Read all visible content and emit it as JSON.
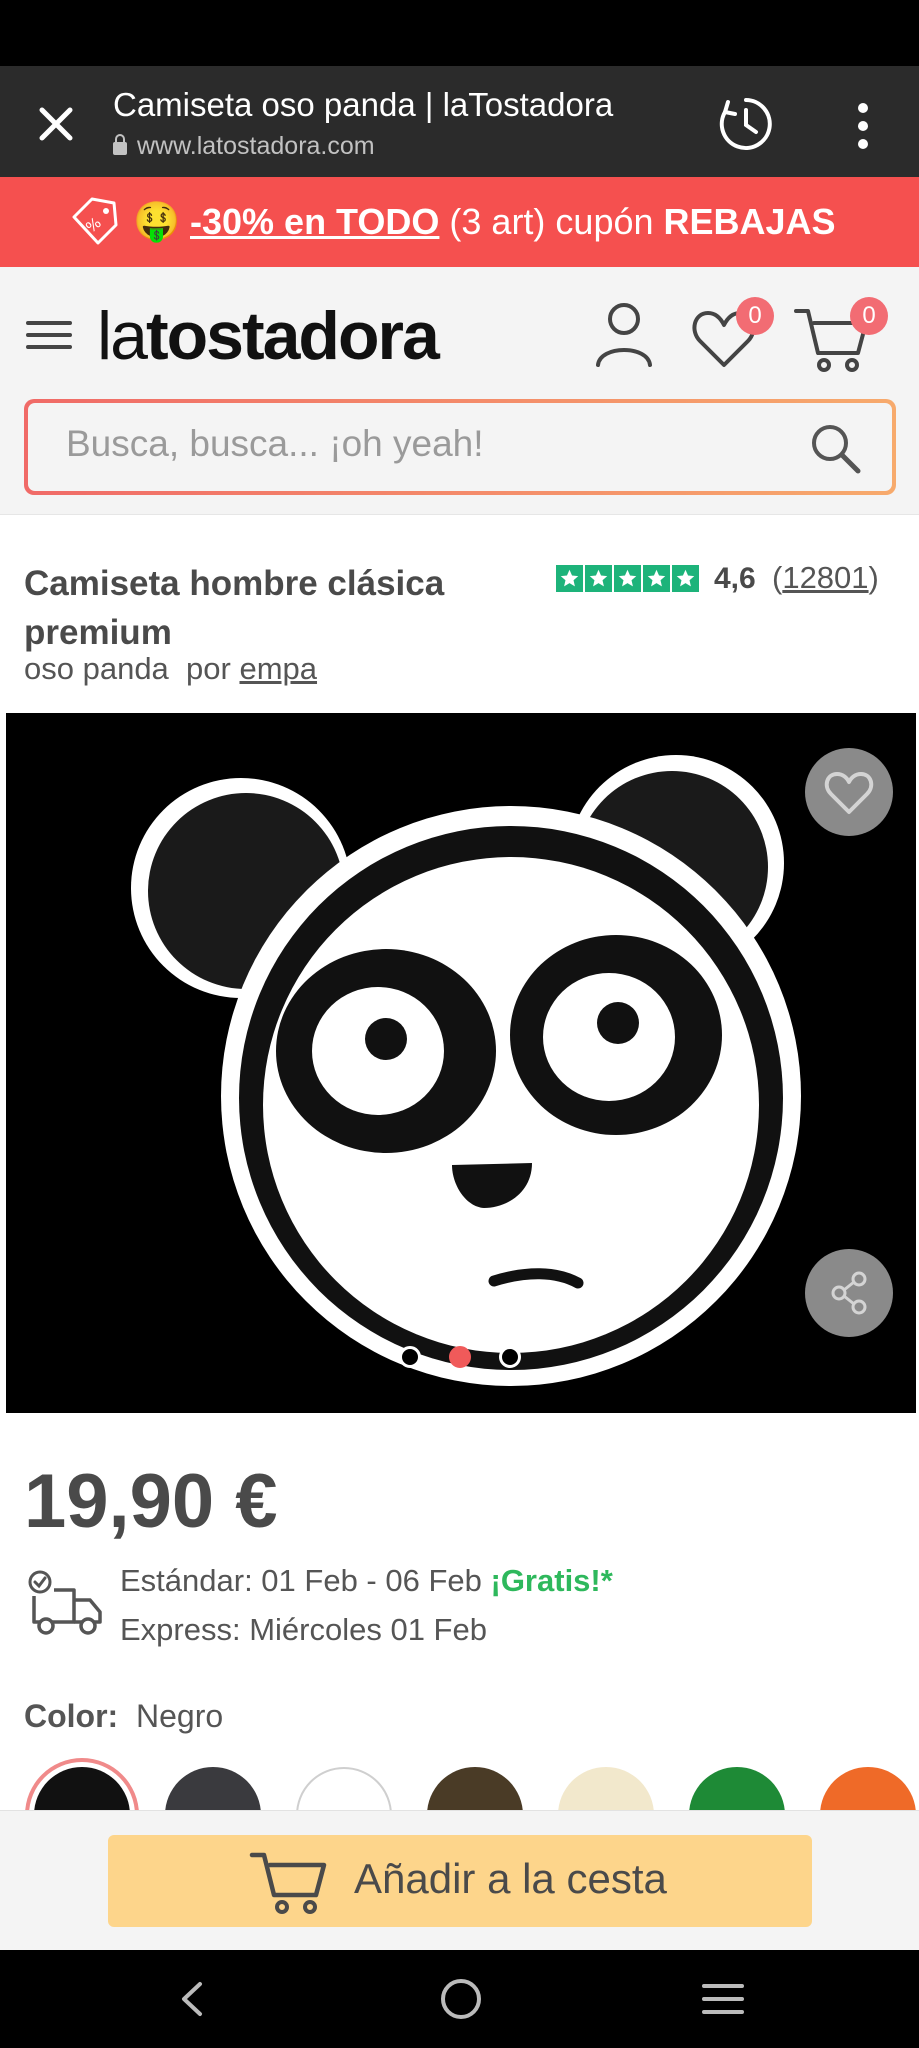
{
  "browser": {
    "title": "Camiseta oso panda | laTostadora",
    "url": "www.latostadora.com"
  },
  "promo": {
    "emoji": "🤑",
    "discount_link": "-30% en TODO",
    "detail": " (3 art) cupón ",
    "code": "REBAJAS",
    "background": "#f5504f"
  },
  "header": {
    "logo_light": "la",
    "logo_bold": "tostadora",
    "wishlist_count": "0",
    "cart_count": "0"
  },
  "search": {
    "placeholder": "Busca, busca... ¡oh yeah!"
  },
  "product": {
    "title": "Camiseta hombre clásica premium",
    "design": "oso panda",
    "by": "por",
    "author": "empa",
    "rating_value": "4,6",
    "rating_count_open": "(",
    "rating_count": "12801",
    "rating_count_close": ")",
    "rating_stars": 5,
    "price": "19,90 €"
  },
  "gallery": {
    "slides_total": 3,
    "active_slide": 2
  },
  "shipping": {
    "standard_label": "Estándar: 01 Feb - 06 Feb ",
    "standard_free": "¡Gratis!*",
    "express_label": "Express: Miércoles 01 Feb"
  },
  "color": {
    "label": "Color:",
    "selected": "Negro",
    "swatches": [
      "#111111",
      "#3a3a3e",
      "#ffffff",
      "#4a3b26",
      "#f2e8cc",
      "#1e8a36",
      "#ef6a28"
    ]
  },
  "cta": {
    "add_to_cart": "Añadir a la cesta",
    "color": "#fdd58b"
  }
}
